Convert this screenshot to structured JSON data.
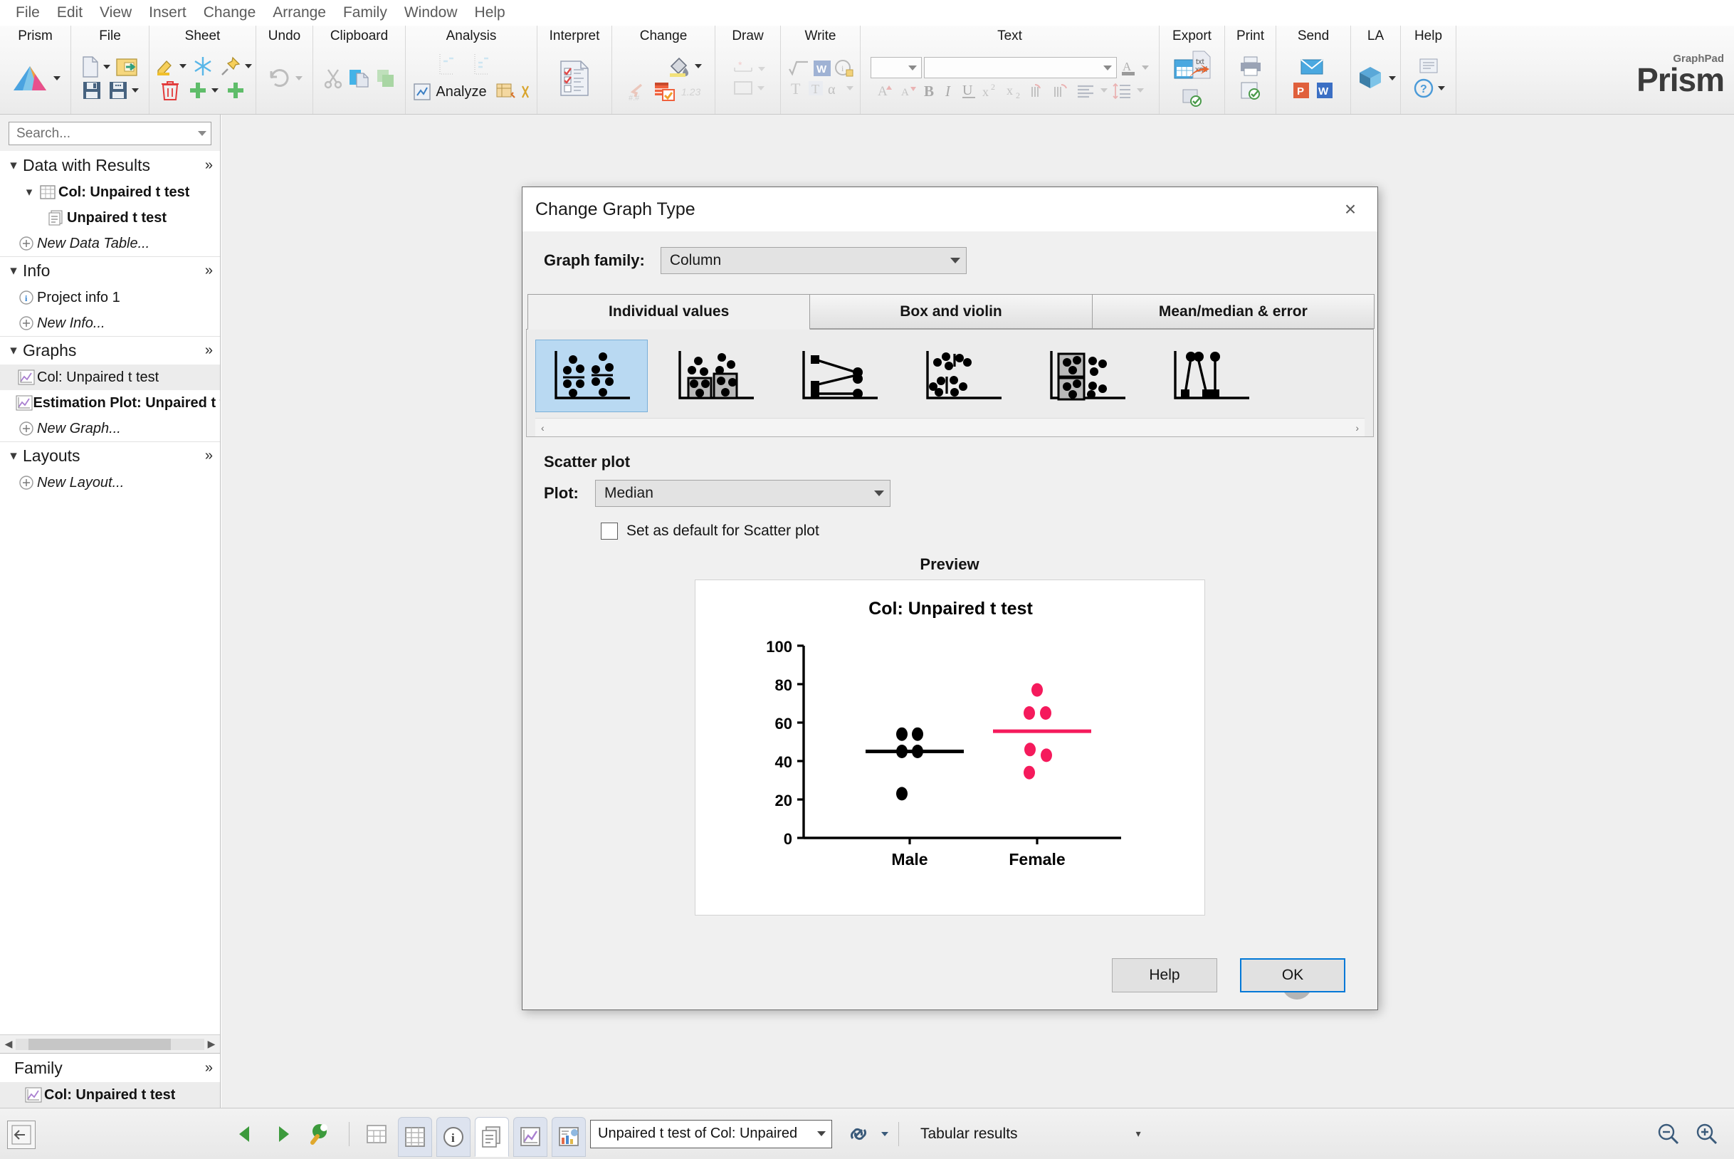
{
  "menubar": {
    "items": [
      "File",
      "Edit",
      "View",
      "Insert",
      "Change",
      "Arrange",
      "Family",
      "Window",
      "Help"
    ]
  },
  "ribbon": {
    "groups": [
      {
        "label": "Prism"
      },
      {
        "label": "File"
      },
      {
        "label": "Sheet"
      },
      {
        "label": "Undo"
      },
      {
        "label": "Clipboard"
      },
      {
        "label": "Analysis",
        "analyze_label": "Analyze"
      },
      {
        "label": "Interpret"
      },
      {
        "label": "Change"
      },
      {
        "label": "Draw"
      },
      {
        "label": "Write"
      },
      {
        "label": "Text"
      },
      {
        "label": "Export"
      },
      {
        "label": "Print"
      },
      {
        "label": "Send"
      },
      {
        "label": "LA"
      },
      {
        "label": "Help"
      }
    ],
    "brand": {
      "small": "GraphPad",
      "name": "Prism"
    },
    "export_badge": "txt\nxml",
    "export_badge_line1": "txt",
    "export_badge_line2": "xml"
  },
  "navigator": {
    "search_placeholder": "Search...",
    "sections": [
      {
        "title": "Data with Results",
        "items": [
          {
            "label": "Col: Unpaired t test",
            "icon": "table-icon",
            "bold": true,
            "indent": 1,
            "expandable": true
          },
          {
            "label": "Unpaired t test",
            "icon": "results-icon",
            "bold": true,
            "indent": 2
          },
          {
            "label": "New Data Table...",
            "icon": "plus-circle-icon",
            "italic": true,
            "indent": 0
          }
        ]
      },
      {
        "title": "Info",
        "items": [
          {
            "label": "Project info 1",
            "icon": "info-icon",
            "indent": 0
          },
          {
            "label": "New Info...",
            "icon": "plus-circle-icon",
            "italic": true,
            "indent": 0
          }
        ]
      },
      {
        "title": "Graphs",
        "items": [
          {
            "label": "Col: Unpaired t test",
            "icon": "graph-icon",
            "indent": 0,
            "selected": true
          },
          {
            "label": "Estimation Plot: Unpaired t test of",
            "icon": "graph-icon",
            "bold": true,
            "indent": 0
          },
          {
            "label": "New Graph...",
            "icon": "plus-circle-icon",
            "italic": true,
            "indent": 0
          }
        ]
      },
      {
        "title": "Layouts",
        "items": [
          {
            "label": "New Layout...",
            "icon": "plus-circle-icon",
            "italic": true,
            "indent": 0
          }
        ]
      }
    ],
    "family": {
      "title": "Family",
      "items": [
        {
          "label": "Col: Unpaired t test",
          "icon": "graph-icon",
          "bold": true,
          "selected": true
        }
      ]
    }
  },
  "dialog": {
    "title": "Change Graph Type",
    "close_label": "×",
    "graph_family_label": "Graph family:",
    "graph_family_value": "Column",
    "tabs": [
      {
        "label": "Individual values",
        "active": true
      },
      {
        "label": "Box and violin",
        "active": false
      },
      {
        "label": "Mean/median & error",
        "active": false
      }
    ],
    "gallery": {
      "thumbs": [
        {
          "name": "scatter-plot-thumb",
          "selected": true
        },
        {
          "name": "scatter-bar-thumb",
          "selected": false
        },
        {
          "name": "before-after-thumb",
          "selected": false
        },
        {
          "name": "scatter-line-thumb",
          "selected": false
        },
        {
          "name": "scatter-box-thumb",
          "selected": false
        },
        {
          "name": "slope-thumb",
          "selected": false
        }
      ],
      "scroll_left": "‹",
      "scroll_right": "›"
    },
    "section_label": "Scatter plot",
    "plot_label": "Plot:",
    "plot_value": "Median",
    "default_checkbox_label": "Set as default for Scatter plot",
    "default_checkbox_checked": false,
    "preview_label": "Preview",
    "buttons": {
      "help": "Help",
      "ok": "OK"
    }
  },
  "chart_data": {
    "type": "scatter",
    "title": "Col: Unpaired t test",
    "xlabel": "",
    "ylabel": "",
    "ylim": [
      0,
      100
    ],
    "yticks": [
      0,
      20,
      40,
      60,
      80,
      100
    ],
    "grid": false,
    "legend": "none",
    "categories": [
      "Male",
      "Female"
    ],
    "series": [
      {
        "name": "Male",
        "color": "#000000",
        "values": [
          54,
          54,
          45,
          45,
          23
        ],
        "median": 45
      },
      {
        "name": "Female",
        "color": "#f51a5c",
        "values": [
          77,
          65,
          65,
          46,
          43,
          34
        ],
        "median": 55.5
      }
    ]
  },
  "statusbar": {
    "sheet_selector_value": "Unpaired t test of Col: Unpaired",
    "results_label": "Tabular results",
    "buttons": [
      {
        "name": "prev-sheet-button",
        "icon": "left-triangle-icon"
      },
      {
        "name": "next-sheet-button",
        "icon": "right-triangle-icon"
      },
      {
        "name": "search-sheet-button",
        "icon": "magnifier-icon"
      },
      {
        "name": "spreadsheet-button",
        "icon": "grid-icon"
      },
      {
        "name": "data-tables-tab",
        "icon": "table-icon"
      },
      {
        "name": "info-tab",
        "icon": "info-icon"
      },
      {
        "name": "results-tab",
        "icon": "results-icon"
      },
      {
        "name": "graphs-tab",
        "icon": "graph-icon"
      },
      {
        "name": "layouts-tab",
        "icon": "layout-icon"
      }
    ],
    "zoom_out": "zoom-out-icon",
    "zoom_in": "zoom-in-icon"
  }
}
